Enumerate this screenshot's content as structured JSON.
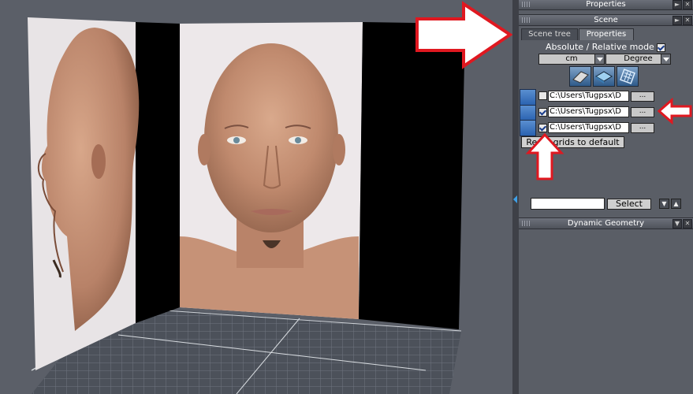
{
  "panels": {
    "properties_title": "Properties",
    "scene_title": "Scene",
    "dynamic_geometry_title": "Dynamic Geometry"
  },
  "tabs": [
    {
      "label": "Scene tree",
      "active": false
    },
    {
      "label": "Properties",
      "active": true
    }
  ],
  "properties": {
    "mode_label": "Absolute / Relative mode",
    "mode_checked": true,
    "unit_value": "cm",
    "angle_value": "Degree"
  },
  "tool_icons": [
    "grid-plane-icon",
    "grid-box-icon",
    "grid-cage-icon"
  ],
  "grid_rows": [
    {
      "checked": false,
      "path": "C:\\Users\\Tugpsx\\D",
      "browse": "..."
    },
    {
      "checked": true,
      "path": "C:\\Users\\Tugpsx\\D",
      "browse": "..."
    },
    {
      "checked": true,
      "path": "C:\\Users\\Tugpsx\\D",
      "browse": "..."
    }
  ],
  "reset_button_label": "Reset grids to default",
  "select_button_label": "Select",
  "window_buttons": {
    "expand": "►",
    "close": "✕",
    "up": "▲",
    "down": "▼"
  },
  "colors": {
    "accent_arrow": "#e01820",
    "panel_bg": "#5a5e66",
    "viewport_bg": "#5b5f68",
    "icon_blue": "#2a62b0"
  }
}
